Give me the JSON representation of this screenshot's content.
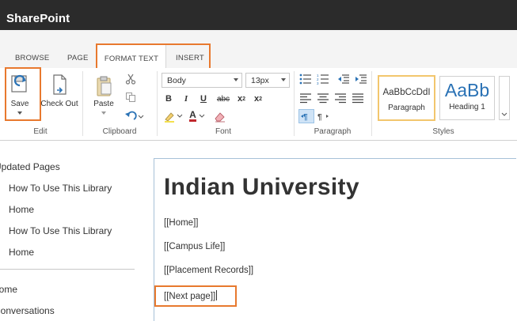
{
  "app": {
    "title": "SharePoint"
  },
  "ribbon_tabs": [
    {
      "label": "BROWSE"
    },
    {
      "label": "PAGE"
    },
    {
      "label": "FORMAT TEXT"
    },
    {
      "label": "INSERT"
    }
  ],
  "edit_group": {
    "save_label": "Save",
    "checkout_label": "Check Out",
    "label": "Edit"
  },
  "clipboard_group": {
    "paste_label": "Paste",
    "label": "Clipboard"
  },
  "font_group": {
    "font_family": "Body",
    "font_size": "13px",
    "bold": "B",
    "italic": "I",
    "underline": "U",
    "strikethrough": "abc",
    "subscript": "x",
    "subscript_mark": "2",
    "superscript": "x",
    "superscript_mark": "2",
    "font_color_letter": "A",
    "label": "Font"
  },
  "paragraph_group": {
    "label": "Paragraph"
  },
  "styles_group": {
    "label": "Styles",
    "items": [
      {
        "preview": "AaBbCcDdI",
        "name": "Paragraph"
      },
      {
        "preview": "AaBb",
        "name": "Heading 1"
      }
    ]
  },
  "left_nav": {
    "section_title": "Updated Pages",
    "items": [
      {
        "label": "How To Use This Library"
      },
      {
        "label": "Home"
      },
      {
        "label": "How To Use This Library"
      },
      {
        "label": "Home"
      }
    ],
    "bottom_items": [
      {
        "label": "Home"
      },
      {
        "label": "Conversations"
      }
    ]
  },
  "editor": {
    "heading": "Indian University",
    "lines": [
      {
        "text": "[[Home]]"
      },
      {
        "text": "[[Campus Life]]"
      },
      {
        "text": "[[Placement Records]]"
      },
      {
        "text": "[[Next page]]"
      }
    ]
  },
  "colors": {
    "suite_bar": "#2b2b2b",
    "highlight": "#e8792e",
    "style_selected": "#f2c66d",
    "accent_blue": "#2a72b5"
  }
}
